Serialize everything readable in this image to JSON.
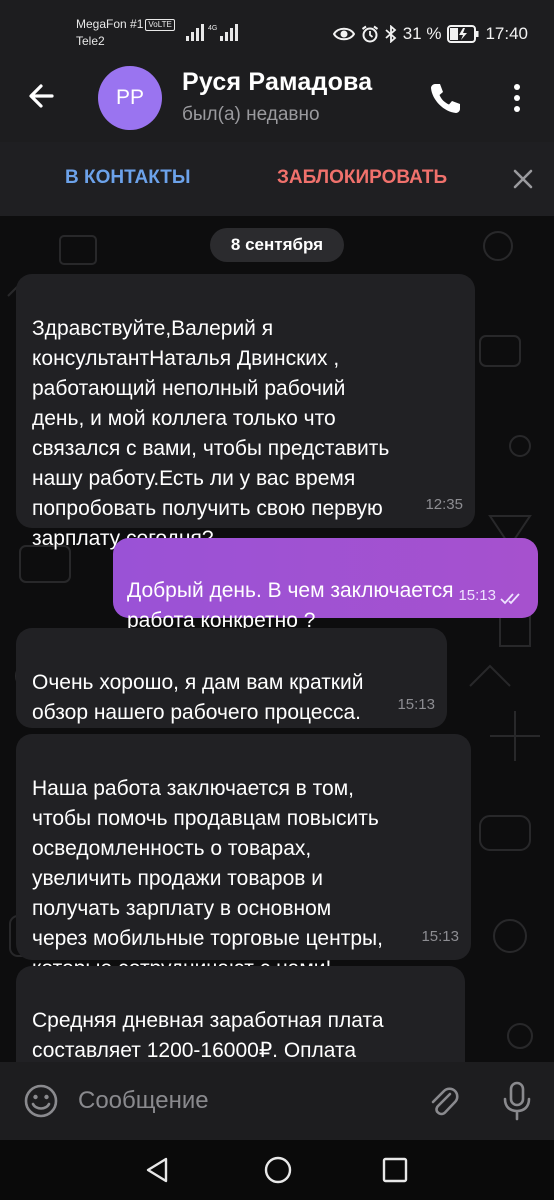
{
  "status_bar": {
    "carrier_1": "MegaFon #1",
    "volte": "VoLTE",
    "carrier_2": "Tele2",
    "network_type": "4G",
    "battery": "31 %",
    "time": "17:40"
  },
  "header": {
    "avatar_initials": "РР",
    "avatar_color": "#9a74f0",
    "contact_name": "Руся Рамадова",
    "last_seen": "был(а) недавно"
  },
  "contact_bar": {
    "add_contact_label": "В КОНТАКТЫ",
    "block_label": "ЗАБЛОКИРОВАТЬ"
  },
  "chat": {
    "date_separator": "8 сентября",
    "messages": [
      {
        "direction": "incoming",
        "text": "Здравствуйте,Валерий     я\nконсультантНаталья Двинских ,\nработающий неполный рабочий\nдень, и мой коллега только что\nсвязался с вами, чтобы представить\nнашу работу.Есть ли у вас время\nпопробовать получить свою первую\nзарплату сегодня?",
        "time": "12:35"
      },
      {
        "direction": "outgoing",
        "text": "Добрый день. В чем заключается\nработа конкретно ?",
        "time": "15:13",
        "read": true
      },
      {
        "direction": "incoming",
        "text": "Очень хорошо, я дам вам краткий\nобзор нашего рабочего процесса.",
        "time": "15:13"
      },
      {
        "direction": "incoming",
        "text": "Наша работа заключается в том,\nчтобы помочь продавцам повысить\nосведомленность о товарах,\nувеличить продажи товаров и\nполучать зарплату в основном\nчерез мобильные торговые центры,\nкоторые сотрудничают с нами!",
        "time": "15:13"
      },
      {
        "direction": "incoming",
        "text": "Средняя дневная заработная плата\nсоставляет 1200-16000₽. Оплата\nза каждое выполненное задание",
        "time": ""
      }
    ]
  },
  "input_bar": {
    "placeholder": "Сообщение"
  },
  "colors": {
    "accent_blue": "#6ca2ea",
    "danger_red": "#f0716c",
    "outgoing_bubble": "#a651ce",
    "incoming_bubble": "#212124"
  }
}
